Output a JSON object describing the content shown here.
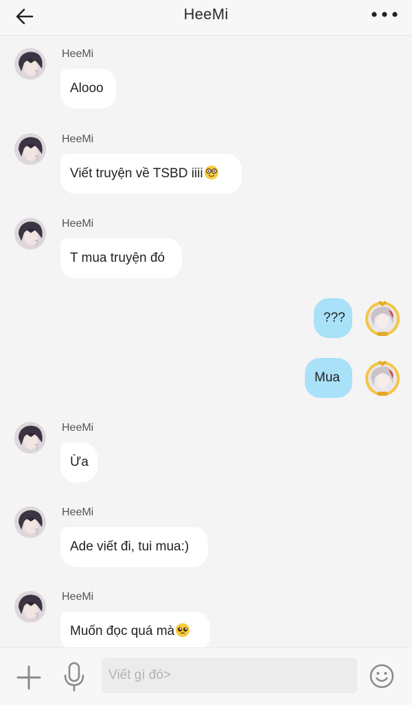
{
  "header": {
    "title": "HeeMi",
    "back_icon": "arrow-left-icon",
    "more_icon": "more-dots-icon"
  },
  "messages": [
    {
      "direction": "incoming",
      "sender": "HeeMi",
      "text": "Alooo"
    },
    {
      "direction": "incoming",
      "sender": "HeeMi",
      "text": "Viết truyện về TSBD iiii",
      "emoji": "nerd-face-emoji"
    },
    {
      "direction": "incoming",
      "sender": "HeeMi",
      "text": "T mua truyện đó"
    },
    {
      "direction": "outgoing",
      "text": "???"
    },
    {
      "direction": "outgoing",
      "text": "Mua"
    },
    {
      "direction": "incoming",
      "sender": "HeeMi",
      "text": "Ừa"
    },
    {
      "direction": "incoming",
      "sender": "HeeMi",
      "text": "Ade viết đi, tui mua:)"
    },
    {
      "direction": "incoming",
      "sender": "HeeMi",
      "text": "Muốn đọc quá mà",
      "emoji": "pleading-face-emoji"
    }
  ],
  "composer": {
    "placeholder": "Viết gì đó>",
    "value": "",
    "plus_icon": "plus-icon",
    "mic_icon": "microphone-icon",
    "emoji_icon": "smiley-icon"
  },
  "colors": {
    "background": "#f4f4f4",
    "incoming_bubble": "#ffffff",
    "outgoing_bubble": "#a9e1f8",
    "text": "#222222"
  }
}
